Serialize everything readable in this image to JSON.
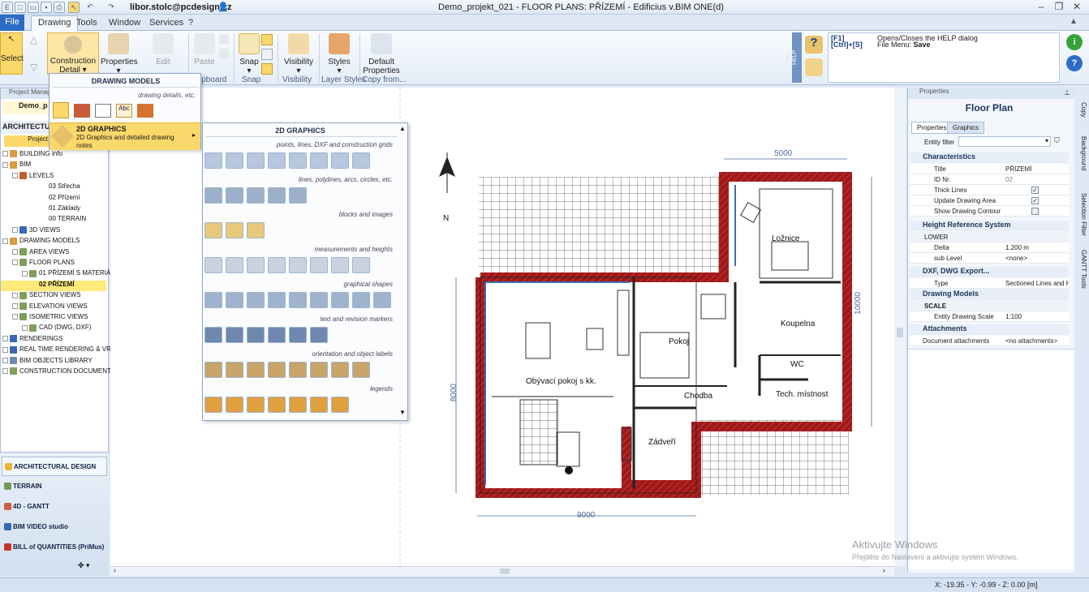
{
  "window": {
    "title": "Demo_projekt_021 - FLOOR PLANS: PŘÍZEMÍ - Edificius v.BIM ONE(d)",
    "user": "libor.stolc@pcdesign.cz"
  },
  "menu": [
    "File",
    "Drawing",
    "Tools",
    "Window",
    "Services",
    "?"
  ],
  "ribbon": {
    "select": "Select",
    "construction": "Construction Detail",
    "properties": "Properties",
    "edit": "Edit",
    "paste": "Paste",
    "snap": "Snap",
    "visibility": "Visibility",
    "styles": "Styles",
    "default_props": "Default Properties",
    "groups": {
      "clipboard": "ipboard",
      "snap": "Snap",
      "visibility": "Visibility",
      "layer_styles": "Layer Styles",
      "copy_from": "Copy from..."
    }
  },
  "help": {
    "tab": "HELP",
    "k1": "[F1]",
    "k2": "[Ctrl]+[S]",
    "d1": "Opens/Closes the HELP dialog",
    "d2_pre": "File Menu: ",
    "d2": "Save"
  },
  "drawing_models_menu": {
    "title": "DRAWING MODELS",
    "subtitle": "drawing details, etc.",
    "item_title": "2D GRAPHICS",
    "item_desc": "2D Graphics and detailed drawing notes"
  },
  "graphics_menu": {
    "title": "2D GRAPHICS",
    "sections": [
      "points, lines, DXF and construction grids",
      "lines, polylines, arcs, circles, etc.",
      "blocks and images",
      "measurements and heights",
      "graphical shapes",
      "text and revision markers",
      "orientation and object labels",
      "legends"
    ]
  },
  "project_manager": {
    "header": "Project Manag",
    "section": "ARCHITECTUR",
    "project": "Demo_p",
    "tab": "Project",
    "tree": [
      "BUILDING info",
      "BIM",
      "LEVELS",
      "03 Střecha",
      "02 Přízemí",
      "01 Základy",
      "00 TERRAIN",
      "3D VIEWS",
      "DRAWING MODELS",
      "AREA VIEWS",
      "FLOOR PLANS",
      "01 PŘÍZEMÍ S MATERIÁLY",
      "02 PŘÍZEMÍ",
      "SECTION VIEWS",
      "ELEVATION VIEWS",
      "ISOMETRIC VIEWS",
      "CAD (DWG, DXF)",
      "RENDERINGS",
      "REAL TIME RENDERING & VRi",
      "BIM OBJECTS LIBRARY",
      "CONSTRUCTION DOCUMENTS"
    ]
  },
  "left_nav": [
    "ARCHITECTURAL DESIGN",
    "TERRAIN",
    "4D - GANTT",
    "BIM VIDEO studio",
    "BILL of QUANTITIES (PriMus)"
  ],
  "plan": {
    "rooms": [
      "Ložnice",
      "Koupelna",
      "Pokoj",
      "WC",
      "Obývací pokoj s kk.",
      "Chodba",
      "Tech. místnost",
      "Zádveří"
    ],
    "dims": [
      "5000",
      "10000",
      "8000",
      "9000"
    ],
    "north": "N"
  },
  "properties": {
    "header": "Properties",
    "title": "Floor Plan",
    "tabs": [
      "Properties",
      "Graphics"
    ],
    "filter": "Entity filter",
    "groups": [
      "Characteristics",
      "Height Reference System",
      "DXF, DWG Export...",
      "Drawing Models",
      "Attachments"
    ],
    "rows": {
      "title": "Title",
      "title_v": "PŘÍZEMÍ",
      "id": "ID Nr.",
      "id_v": "02",
      "thick": "Thick Lines",
      "update": "Update Drawing Area",
      "contour": "Show Drawing Contour",
      "lower": "LOWER",
      "delta": "Delta",
      "delta_v": "1.200 m",
      "sublevel": "sub Level",
      "sublevel_v": "<none>",
      "type": "Type",
      "type_v": "Sectioned Lines and Ha",
      "scale": "SCALE",
      "eds": "Entity Drawing Scale",
      "eds_v": "1:100",
      "doc": "Document attachments",
      "doc_v": "<no attachments>"
    }
  },
  "vtabs": [
    "Copy",
    "Background",
    "Selection Filter",
    "GANTT Tools"
  ],
  "status": {
    "coords": "X: -19.35 - Y: -0.99 - Z: 0.00 [m]"
  },
  "watermark": {
    "l1": "Aktivujte Windows",
    "l2": "Přejděte do Nastavení a aktivujte systém Windows."
  }
}
